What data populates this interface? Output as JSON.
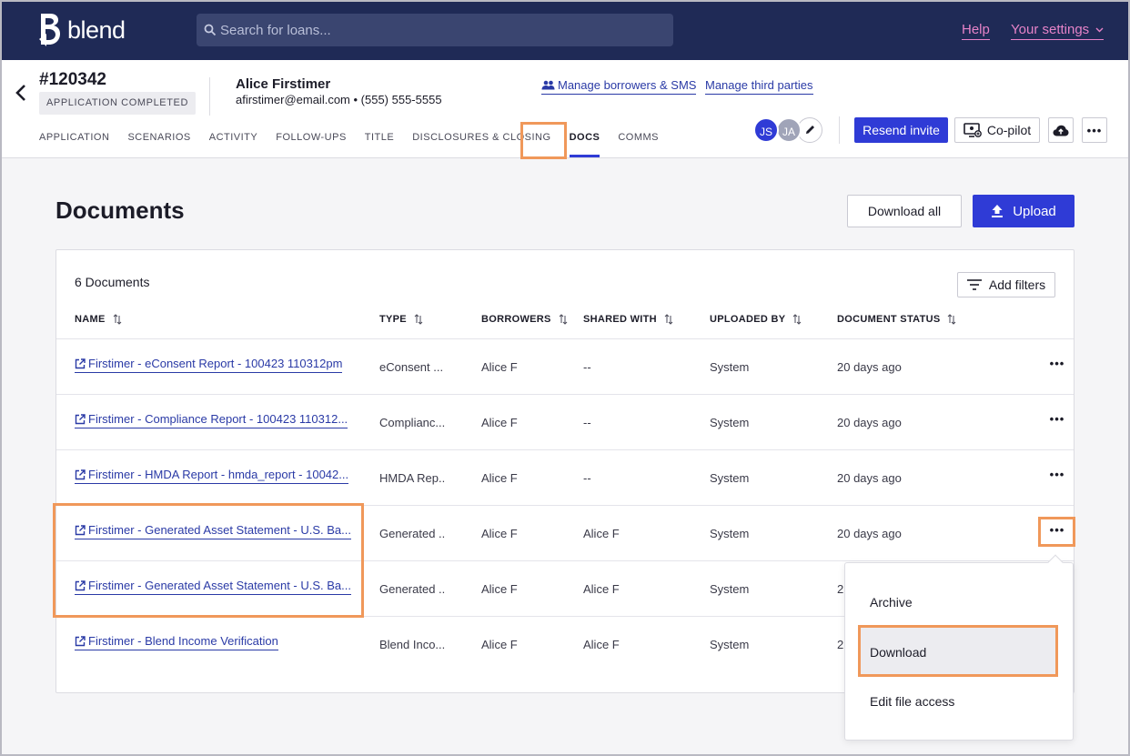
{
  "topbar": {
    "logo_text": "blend",
    "search_placeholder": "Search for loans...",
    "help": "Help",
    "settings": "Your settings"
  },
  "loan": {
    "number": "#120342",
    "status": "APPLICATION COMPLETED",
    "borrower_name": "Alice Firstimer",
    "borrower_contact": "afirstimer@email.com • (555) 555-5555",
    "manage_borrowers": "Manage borrowers & SMS",
    "manage_third_parties": "Manage third parties"
  },
  "tabs": [
    {
      "label": "APPLICATION"
    },
    {
      "label": "SCENARIOS"
    },
    {
      "label": "ACTIVITY"
    },
    {
      "label": "FOLLOW-UPS"
    },
    {
      "label": "TITLE"
    },
    {
      "label": "DISCLOSURES & CLOSING"
    },
    {
      "label": "DOCS",
      "active": true
    },
    {
      "label": "COMMS"
    }
  ],
  "avatars": {
    "js": "JS",
    "ja": "JA"
  },
  "actions": {
    "resend_invite": "Resend invite",
    "copilot": "Co-pilot",
    "more": "•••"
  },
  "documents": {
    "title": "Documents",
    "download_all": "Download all",
    "upload": "Upload",
    "count": "6 Documents",
    "add_filters": "Add filters",
    "columns": [
      "NAME",
      "TYPE",
      "BORROWERS",
      "SHARED WITH",
      "UPLOADED BY",
      "DOCUMENT STATUS"
    ],
    "rows": [
      {
        "name": "Firstimer - eConsent Report - 100423 110312pm",
        "type": "eConsent ...",
        "borrowers": "Alice F",
        "shared": "--",
        "uploaded_by": "System",
        "status": "20 days ago"
      },
      {
        "name": "Firstimer - Compliance Report - 100423 110312...",
        "type": "Complianc...",
        "borrowers": "Alice F",
        "shared": "--",
        "uploaded_by": "System",
        "status": "20 days ago"
      },
      {
        "name": "Firstimer - HMDA Report - hmda_report - 10042...",
        "type": "HMDA Rep...",
        "borrowers": "Alice F",
        "shared": "--",
        "uploaded_by": "System",
        "status": "20 days ago"
      },
      {
        "name": "Firstimer - Generated Asset Statement - U.S. Ba...",
        "type": "Generated ...",
        "borrowers": "Alice F",
        "shared": "Alice F",
        "uploaded_by": "System",
        "status": "20 days ago"
      },
      {
        "name": "Firstimer - Generated Asset Statement - U.S. Ba...",
        "type": "Generated ...",
        "borrowers": "Alice F",
        "shared": "Alice F",
        "uploaded_by": "System",
        "status": "2"
      },
      {
        "name": "Firstimer - Blend Income Verification",
        "type": "Blend Inco...",
        "borrowers": "Alice F",
        "shared": "Alice F",
        "uploaded_by": "System",
        "status": "2"
      }
    ],
    "row_more": "•••"
  },
  "menu": {
    "items": [
      "Archive",
      "Download",
      "Edit file access"
    ]
  },
  "colors": {
    "nav_bg": "#1f2a56",
    "primary": "#2f3bd6",
    "link": "#2a3aa6",
    "top_link": "#e683c8",
    "highlight": "#f0985a"
  }
}
